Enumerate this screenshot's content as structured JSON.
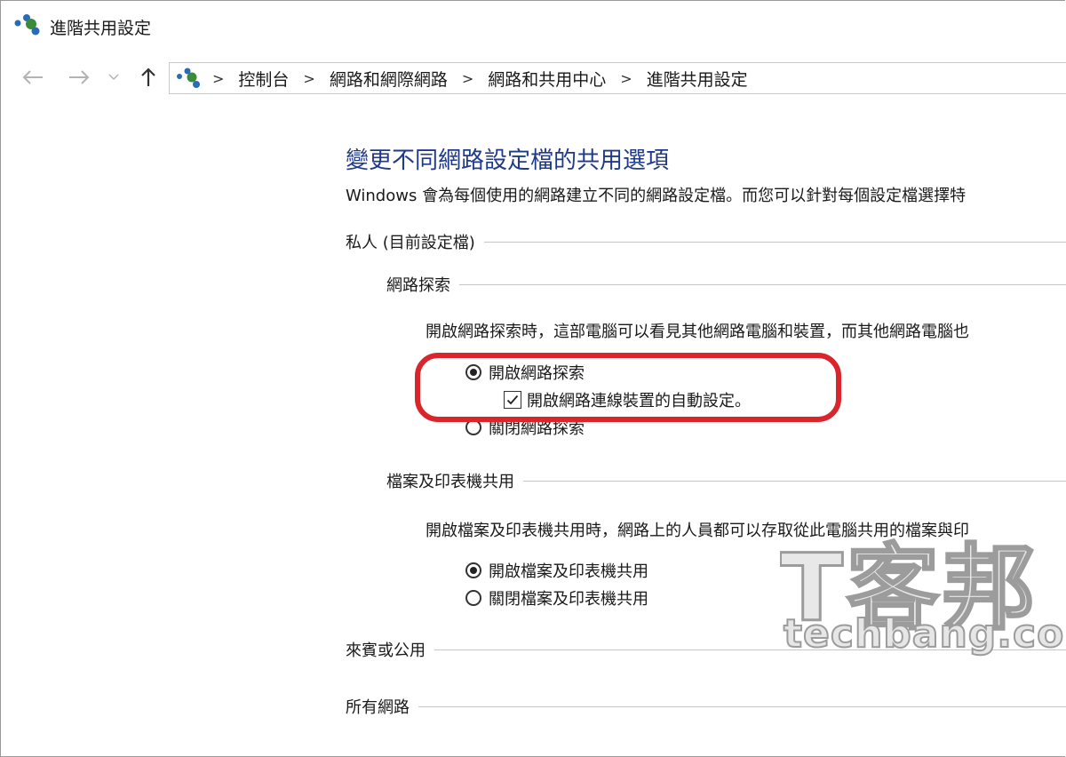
{
  "window": {
    "title": "進階共用設定",
    "icon": "network-sharing-icon"
  },
  "nav": {
    "back_icon": "arrow-left-icon",
    "forward_icon": "arrow-right-icon",
    "recent_icon": "chevron-down-icon",
    "up_icon": "arrow-up-icon",
    "breadcrumb": [
      "控制台",
      "網路和網際網路",
      "網路和共用中心",
      "進階共用設定"
    ]
  },
  "main": {
    "heading": "變更不同網路設定檔的共用選項",
    "description": "Windows 會為每個使用的網路建立不同的網路設定檔。而您可以針對每個設定檔選擇特",
    "private_profile": {
      "label": "私人 (目前設定檔)",
      "network_discovery": {
        "label": "網路探索",
        "description": "開啟網路探索時，這部電腦可以看見其他網路電腦和裝置，而其他網路電腦也",
        "option_on": "開啟網路探索",
        "option_on_selected": true,
        "auto_setup": "開啟網路連線裝置的自動設定。",
        "auto_setup_checked": true,
        "option_off": "關閉網路探索",
        "option_off_selected": false
      },
      "file_printer_sharing": {
        "label": "檔案及印表機共用",
        "description": "開啟檔案及印表機共用時，網路上的人員都可以存取從此電腦共用的檔案與印",
        "option_on": "開啟檔案及印表機共用",
        "option_on_selected": true,
        "option_off": "關閉檔案及印表機共用",
        "option_off_selected": false
      }
    },
    "guest_public_label": "來賓或公用",
    "all_networks_label": "所有網路"
  },
  "watermark": {
    "text": "T客邦",
    "site": "techbang.com"
  },
  "colors": {
    "heading": "#1f3a8a",
    "highlight": "#d9262c"
  }
}
